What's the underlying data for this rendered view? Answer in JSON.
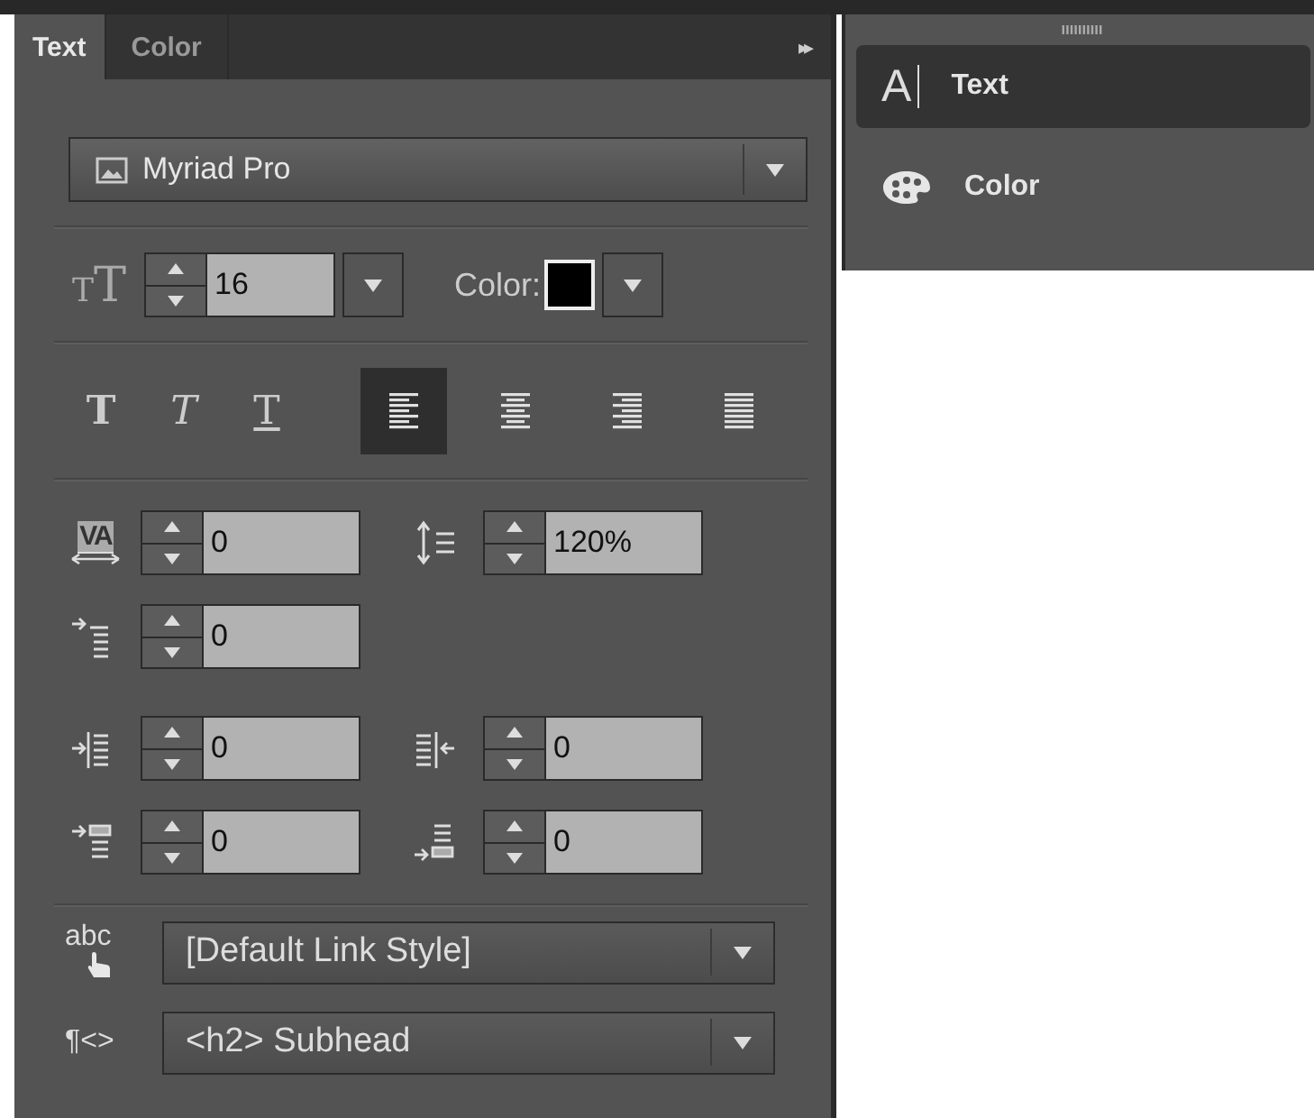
{
  "tabs": [
    {
      "label": "Text",
      "selected": true
    },
    {
      "label": "Color",
      "selected": false
    }
  ],
  "panel_menu": "▸▸",
  "font": {
    "value": "Myriad Pro"
  },
  "size": {
    "icon_text": "TT",
    "value": "16"
  },
  "color": {
    "label": "Color:",
    "color": "#000000"
  },
  "styles": [
    {
      "kind": "bold",
      "label": "T"
    },
    {
      "kind": "italic",
      "label": "T"
    },
    {
      "kind": "underline",
      "label": "T"
    }
  ],
  "alignment": [
    {
      "kind": "left",
      "selected": true
    },
    {
      "kind": "center",
      "selected": false
    },
    {
      "kind": "right",
      "selected": false
    },
    {
      "kind": "justify",
      "selected": false
    }
  ],
  "spinner_rows": [
    [
      {
        "kind": "tracking",
        "icon_text": "VA",
        "value": "0"
      },
      {
        "kind": "leading",
        "value": "120%"
      }
    ],
    [
      {
        "kind": "text-indent",
        "value": "0"
      }
    ],
    [
      {
        "kind": "left-indent",
        "value": "0"
      },
      {
        "kind": "right-indent",
        "value": "0"
      }
    ],
    [
      {
        "kind": "space-before",
        "value": "0"
      },
      {
        "kind": "space-after",
        "value": "0"
      }
    ]
  ],
  "link_style": {
    "icon_text": "abc",
    "value": "[Default Link Style]"
  },
  "paragraph_format": {
    "icon_text": "¶<>",
    "value": "<h2> Subhead"
  },
  "dock": [
    {
      "kind": "text",
      "icon_text": "A",
      "label": "Text",
      "selected": true
    },
    {
      "kind": "color",
      "label": "Color",
      "selected": false
    }
  ]
}
